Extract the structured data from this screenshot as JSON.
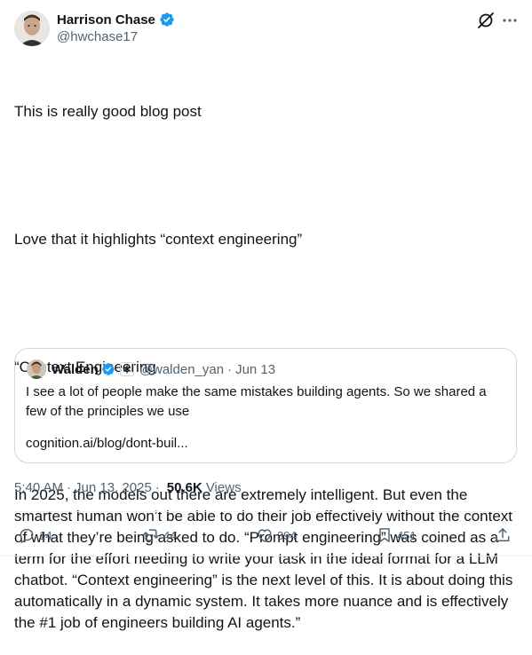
{
  "author": {
    "name": "Harrison Chase",
    "handle": "@hwchase17"
  },
  "tweet": {
    "lines": [
      "This is really good blog post",
      "",
      "Love that it highlights “context engineering”",
      "",
      "“Context Engineering",
      "",
      "In 2025, the models out there are extremely intelligent. But even the smartest human won’t be able to do their job effectively without the context of what they’re being asked to do. “Prompt engineering” was coined as a term for the effort needing to write your task in the ideal format for a LLM chatbot. “Context engineering” is the next level of this. It is about doing this automatically in a dynamic system. It takes more nuance and is effectively the #1 job of engineers building AI agents.”"
    ]
  },
  "quote": {
    "name": "Walden",
    "handle": "@walden_yan",
    "dot": "·",
    "date": "Jun 13",
    "badge_icon": "snowflake-icon",
    "text": "I see a lot of people make the same mistakes building agents. So we shared a few of the principles we use",
    "link": "cognition.ai/blog/dont-buil..."
  },
  "meta": {
    "time": "5:40 AM",
    "date": "Jun 13, 2025",
    "separator": "·",
    "views_count": "50.6K",
    "views_label": "Views"
  },
  "actions": {
    "replies": "14",
    "reposts": "44",
    "likes": "394",
    "bookmarks": "451"
  },
  "colors": {
    "verified": "#1d9bf0",
    "secondary_text": "#536471",
    "border": "#cfd9de"
  }
}
